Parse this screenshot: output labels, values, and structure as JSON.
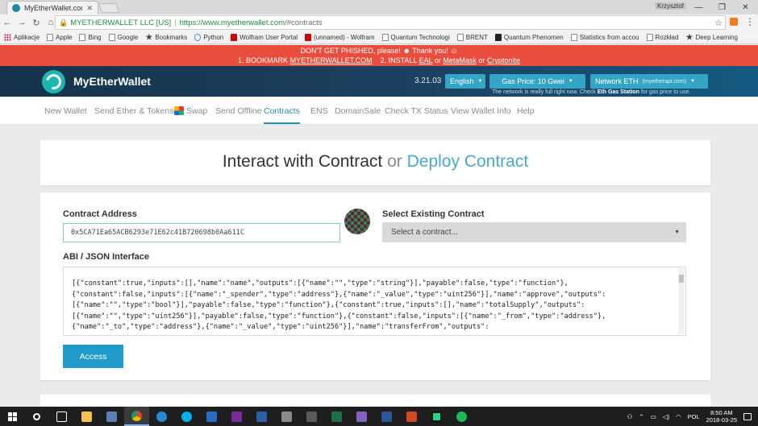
{
  "browser": {
    "tab_title": "MyEtherWallet.com",
    "user_name": "Krzysztof",
    "secure_label": "MYETHERWALLET LLC [US]",
    "url_host": "https://www.myetherwallet.com",
    "url_path": "/#contracts",
    "bookmarks": [
      {
        "label": "Aplikacje",
        "icon": "apps-icon"
      },
      {
        "label": "Apple",
        "icon": "page-icon"
      },
      {
        "label": "Bing",
        "icon": "page-icon"
      },
      {
        "label": "Google",
        "icon": "page-icon"
      },
      {
        "label": "Bookmarks",
        "icon": "star-icon"
      },
      {
        "label": "Python",
        "icon": "python-icon"
      },
      {
        "label": "Wolfram User Portal",
        "icon": "wolfram-icon"
      },
      {
        "label": "(unnamed) - Wolfram",
        "icon": "wolfram-icon"
      },
      {
        "label": "Quantum Technologi",
        "icon": "page-icon"
      },
      {
        "label": "BRENT",
        "icon": "page-icon"
      },
      {
        "label": "Quantum Phenomen",
        "icon": "dark-icon"
      },
      {
        "label": "Statistics from accou",
        "icon": "page-icon"
      },
      {
        "label": "Rozkład",
        "icon": "page-icon"
      },
      {
        "label": "Deep Learning",
        "icon": "star-icon"
      }
    ]
  },
  "warning": {
    "line1_a": "DON'T GET PHISHED, please!",
    "line1_b": "Thank you!",
    "line2_a": "1. BOOKMARK",
    "line2_link1": "MYETHERWALLET.COM",
    "line2_b": "2. INSTALL",
    "line2_link2": "EAL",
    "line2_or1": "or",
    "line2_link3": "MetaMask",
    "line2_or2": "or",
    "line2_link4": "Cryptonite"
  },
  "header": {
    "logo_text": "MyEtherWallet",
    "version": "3.21.03",
    "language": "English",
    "gas_price": "Gas Price: 10 Gwei",
    "network": "Network ETH",
    "network_provider": "(myetherapi.com)",
    "gas_note_a": "The network is really full right now. Check",
    "gas_note_link": "Eth Gas Station",
    "gas_note_b": "for gas price to use."
  },
  "nav": {
    "items": [
      {
        "label": "New Wallet"
      },
      {
        "label": "Send Ether & Tokens"
      },
      {
        "label": "Swap"
      },
      {
        "label": "Send Offline"
      },
      {
        "label": "Contracts"
      },
      {
        "label": "ENS"
      },
      {
        "label": "DomainSale"
      },
      {
        "label": "Check TX Status"
      },
      {
        "label": "View Wallet Info"
      },
      {
        "label": "Help"
      }
    ],
    "active": "Contracts"
  },
  "title": {
    "interact": "Interact with Contract",
    "or": "or",
    "deploy": "Deploy Contract"
  },
  "contract": {
    "address_label": "Contract Address",
    "address_value": "0x5CA71Ea65ACB6293e71E62c41B720698b0Aa611C",
    "existing_label": "Select Existing Contract",
    "select_placeholder": "Select a contract...",
    "abi_label": "ABI / JSON Interface",
    "abi_value": "[{\"constant\":true,\"inputs\":[],\"name\":\"name\",\"outputs\":[{\"name\":\"\",\"type\":\"string\"}],\"payable\":false,\"type\":\"function\"},\n{\"constant\":false,\"inputs\":[{\"name\":\"_spender\",\"type\":\"address\"},{\"name\":\"_value\",\"type\":\"uint256\"}],\"name\":\"approve\",\"outputs\":\n[{\"name\":\"\",\"type\":\"bool\"}],\"payable\":false,\"type\":\"function\"},{\"constant\":true,\"inputs\":[],\"name\":\"totalSupply\",\"outputs\":\n[{\"name\":\"\",\"type\":\"uint256\"}],\"payable\":false,\"type\":\"function\"},{\"constant\":false,\"inputs\":[{\"name\":\"_from\",\"type\":\"address\"},\n{\"name\":\"_to\",\"type\":\"address\"},{\"name\":\"_value\",\"type\":\"uint256\"}],\"name\":\"transferFrom\",\"outputs\":",
    "access_label": "Access"
  },
  "taskbar": {
    "time": "8:50 AM",
    "date": "2018-03-25",
    "lang": "POL"
  }
}
